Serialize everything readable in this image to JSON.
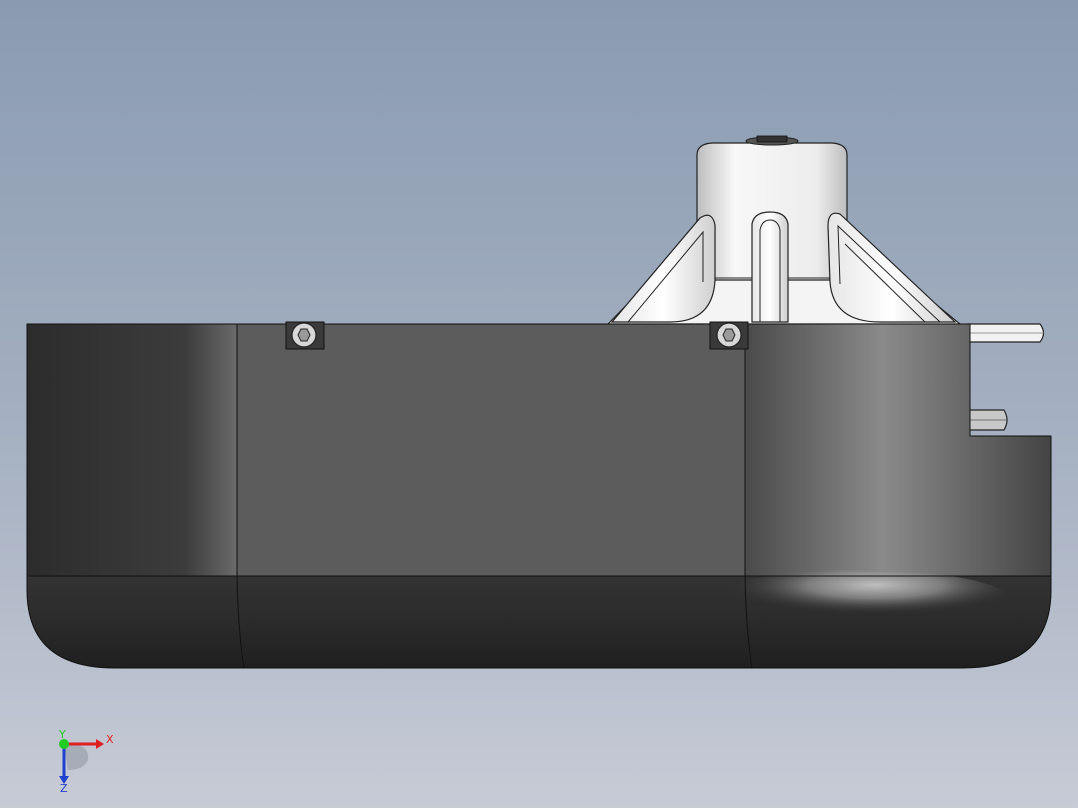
{
  "viewport": {
    "background_top": "#8a9bb1",
    "background_bottom": "#c7cbd6",
    "model": {
      "body_color": "#555555",
      "shade_dark": "#2f2f2f",
      "cap_color": "#f2f2f2",
      "edge_color": "#111111"
    }
  },
  "triad": {
    "x_label": "X",
    "y_label": "Y",
    "z_label": "Z",
    "x_color": "#e02020",
    "y_color": "#22cc22",
    "z_color": "#2040d0"
  }
}
